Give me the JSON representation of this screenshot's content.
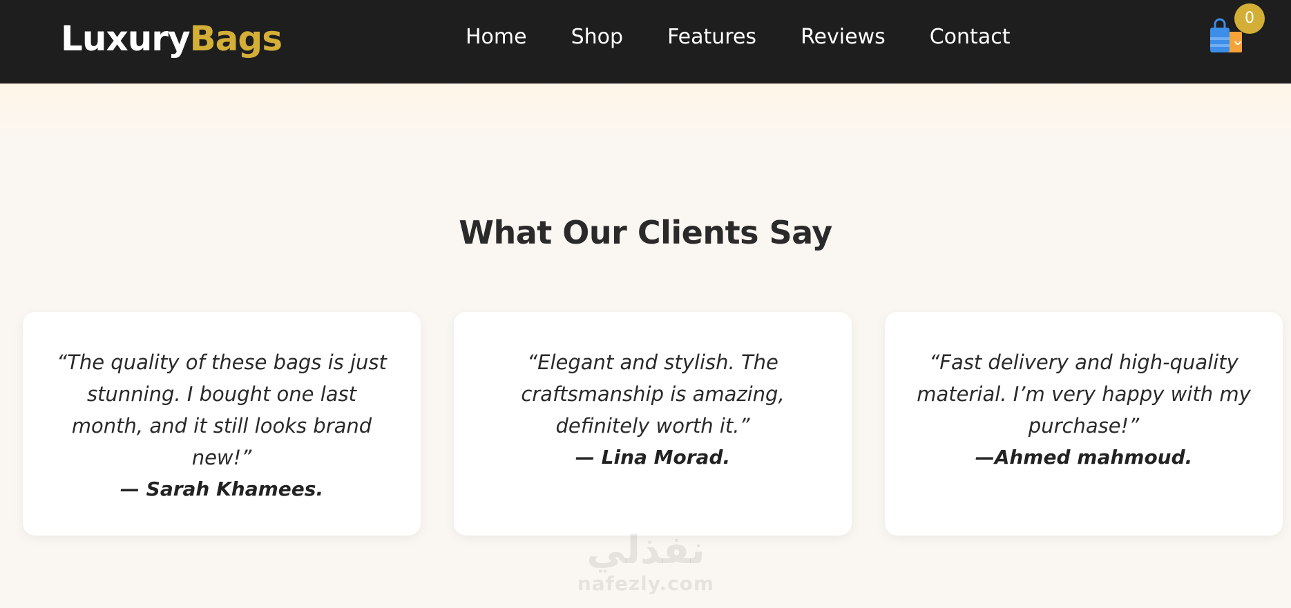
{
  "brand": {
    "part1": "Luxury",
    "part2": "Bags",
    "accent": "#d4af37"
  },
  "nav": {
    "items": [
      {
        "label": "Home"
      },
      {
        "label": "Shop"
      },
      {
        "label": "Features"
      },
      {
        "label": "Reviews"
      },
      {
        "label": "Contact"
      }
    ]
  },
  "cart": {
    "count": "0",
    "icon": "shopping-bag-icon"
  },
  "testimonials": {
    "title": "What Our Clients Say",
    "items": [
      {
        "quote": "“The quality of these bags is just stunning. I bought one last month, and it still looks brand new!”",
        "author": "— Sarah Khamees."
      },
      {
        "quote": "“Elegant and stylish. The craftsmanship is amazing, definitely worth it.”",
        "author": "— Lina Morad."
      },
      {
        "quote": "“Fast delivery and high-quality material. I’m very happy with my purchase!”",
        "author": "—Ahmed mahmoud."
      }
    ]
  },
  "watermark": {
    "arabic": "نفذلي",
    "latin": "nafezly.com"
  },
  "colors": {
    "navbar": "#1e1e1e",
    "background": "#faf7f2",
    "card": "#ffffff"
  }
}
